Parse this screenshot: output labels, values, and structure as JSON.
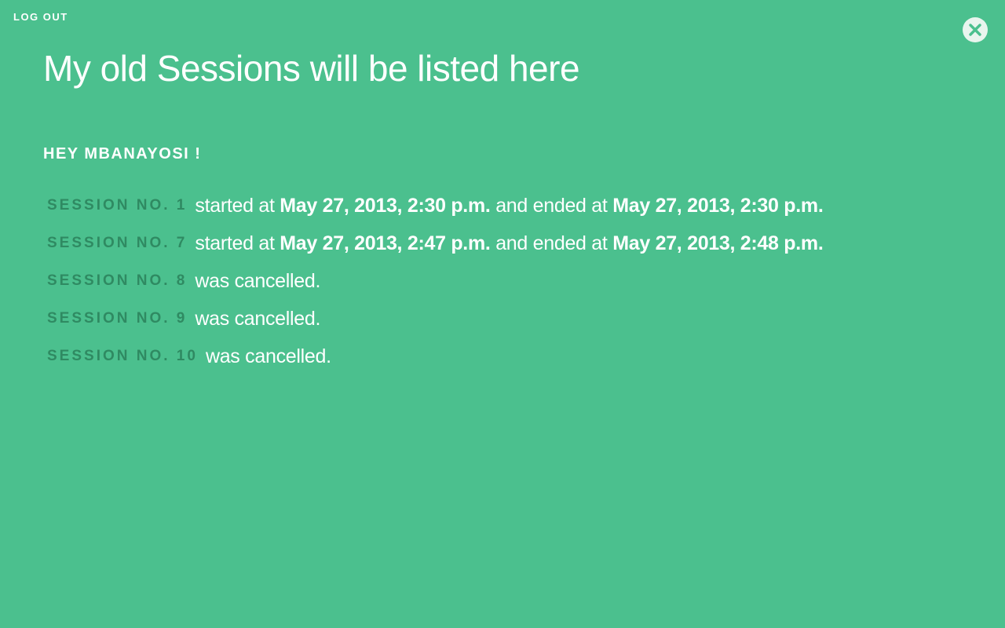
{
  "header": {
    "logout_label": "LOG OUT",
    "close_icon": "close-icon"
  },
  "page": {
    "title": "My old Sessions will be listed here",
    "greeting": "HEY MBANAYOSI !"
  },
  "sessions": [
    {
      "label": "SESSION NO. 1",
      "started_text": "started at",
      "start": "May 27, 2013, 2:30 p.m.",
      "ended_text": "and ended at",
      "end": "May 27, 2013, 2:30 p.m."
    },
    {
      "label": "SESSION NO. 7",
      "started_text": "started at",
      "start": "May 27, 2013, 2:47 p.m.",
      "ended_text": "and ended at",
      "end": "May 27, 2013, 2:48 p.m."
    },
    {
      "label": "SESSION NO. 8",
      "status": "was cancelled."
    },
    {
      "label": "SESSION NO. 9",
      "status": "was cancelled."
    },
    {
      "label": "SESSION NO. 10",
      "status": "was cancelled."
    }
  ],
  "colors": {
    "background": "#4bc08e",
    "label": "#2f8a62",
    "text": "#ffffff",
    "close_button_bg": "#e9f5ee",
    "close_button_x": "#4bc08e"
  }
}
